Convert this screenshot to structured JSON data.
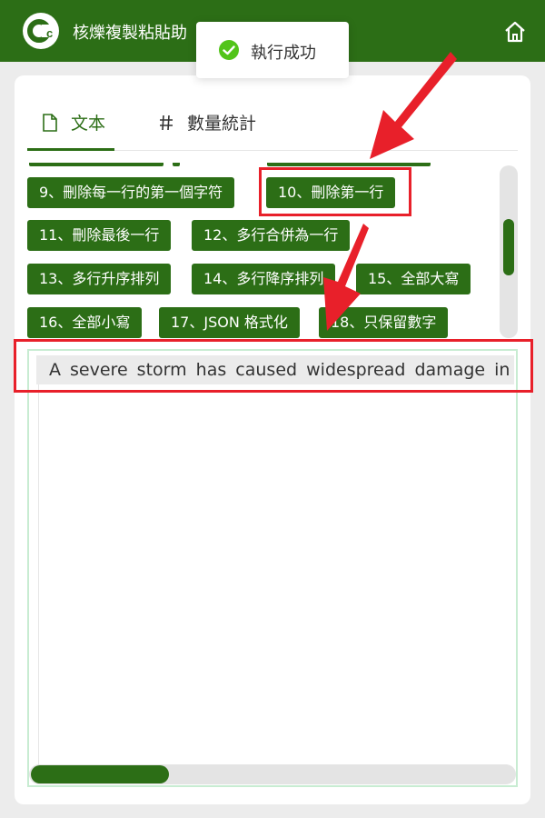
{
  "app": {
    "title": "核爍複製粘貼助",
    "logo_icon": "cc-logo",
    "home_icon": "home-icon",
    "brand_color": "#2c6e16"
  },
  "toast": {
    "text": "執行成功",
    "icon": "check-circle-icon",
    "icon_color": "#52c41a"
  },
  "tabs": [
    {
      "label": "文本",
      "icon": "document-icon",
      "active": true
    },
    {
      "label": "數量統計",
      "icon": "hash-icon",
      "active": false
    }
  ],
  "buttons": [
    "9、刪除每一行的第一個字符",
    "10、刪除第一行",
    "11、刪除最後一行",
    "12、多行合併為一行",
    "13、多行升序排列",
    "14、多行降序排列",
    "15、全部大寫",
    "16、全部小寫",
    "17、JSON 格式化",
    "18、只保留數字"
  ],
  "editor": {
    "first_line": "A severe storm has caused widespread damage in"
  },
  "annotations": {
    "highlight_color": "#e8202a"
  }
}
